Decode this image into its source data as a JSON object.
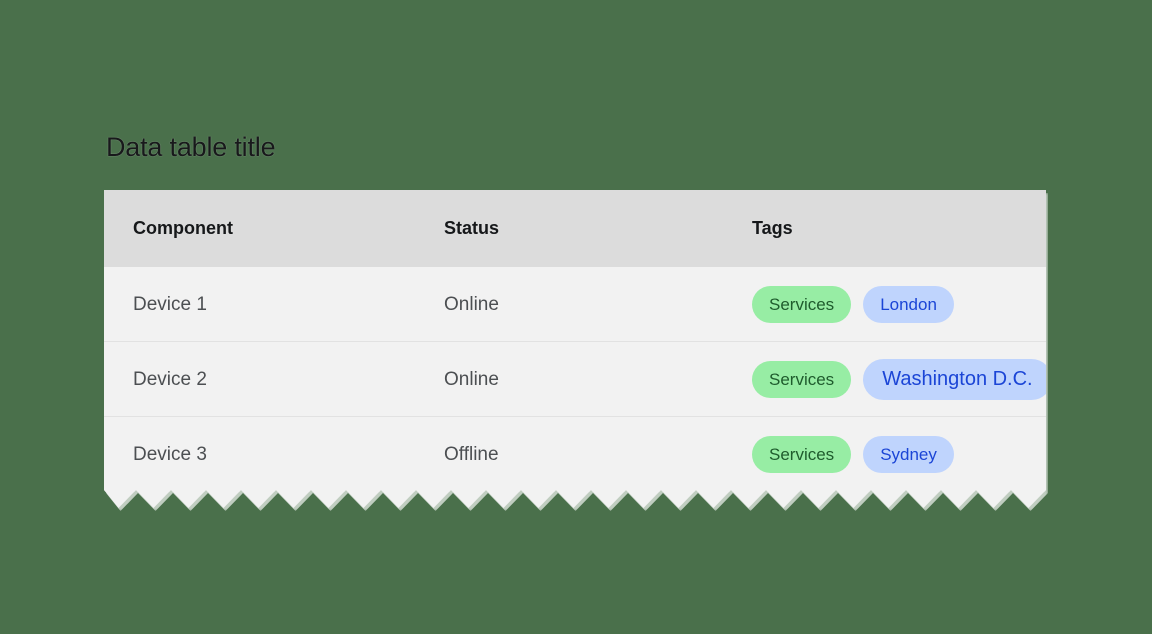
{
  "page": {
    "background_color": "#4a704b"
  },
  "title": "Data table title",
  "table": {
    "header_background": "#dcdcdc",
    "row_background": "#f2f2f2",
    "row_divider_color": "#e2e2e2",
    "columns": [
      "Component",
      "Status",
      "Tags"
    ],
    "rows": [
      {
        "component": "Device 1",
        "status": "Online",
        "tags": [
          {
            "label": "Services",
            "color": "#97eda4",
            "text_color": "#1f5c2d",
            "size": "normal"
          },
          {
            "label": "London",
            "color": "#bfd4fd",
            "text_color": "#1b45d6",
            "size": "normal"
          }
        ]
      },
      {
        "component": "Device 2",
        "status": "Online",
        "tags": [
          {
            "label": "Services",
            "color": "#97eda4",
            "text_color": "#1f5c2d",
            "size": "normal"
          },
          {
            "label": "Washington D.C.",
            "color": "#bfd4fd",
            "text_color": "#1b45d6",
            "size": "large"
          }
        ]
      },
      {
        "component": "Device 3",
        "status": "Offline",
        "tags": [
          {
            "label": "Services",
            "color": "#97eda4",
            "text_color": "#1f5c2d",
            "size": "normal"
          },
          {
            "label": "Sydney",
            "color": "#bfd4fd",
            "text_color": "#1b45d6",
            "size": "normal"
          }
        ]
      }
    ]
  }
}
